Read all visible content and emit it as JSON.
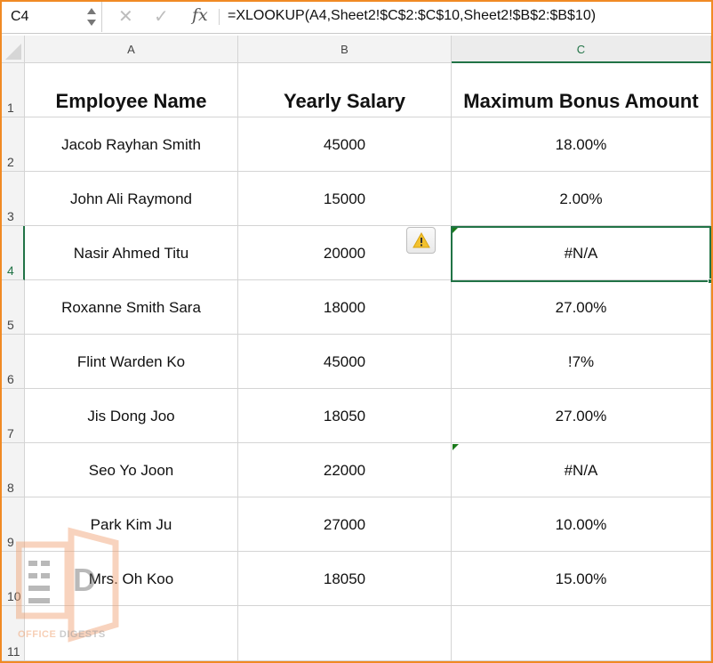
{
  "formula_bar": {
    "name_box": "C4",
    "cancel_icon": "x-icon",
    "enter_icon": "check-icon",
    "fx_label": "fx",
    "formula": "=XLOOKUP(A4,Sheet2!$C$2:$C$10,Sheet2!$B$2:$B$10)"
  },
  "columns": [
    "A",
    "B",
    "C"
  ],
  "selected_column": "C",
  "rows": [
    "1",
    "2",
    "3",
    "4",
    "5",
    "6",
    "7",
    "8",
    "9",
    "10",
    "11"
  ],
  "selected_row": "4",
  "selected_cell": "C4",
  "table": {
    "headers": [
      "Employee Name",
      "Yearly Salary",
      "Maximum Bonus Amount"
    ],
    "data": [
      [
        "Jacob Rayhan Smith",
        "45000",
        "18.00%"
      ],
      [
        "John Ali Raymond",
        "15000",
        "2.00%"
      ],
      [
        "Nasir Ahmed Titu",
        "20000",
        "#N/A"
      ],
      [
        "Roxanne Smith Sara",
        "18000",
        "27.00%"
      ],
      [
        "Flint Warden Ko",
        "45000",
        "!7%"
      ],
      [
        "Jis Dong Joo",
        "18050",
        "27.00%"
      ],
      [
        "Seo Yo Joon",
        "22000",
        "#N/A"
      ],
      [
        "Park Kim Ju",
        "27000",
        "10.00%"
      ],
      [
        "Mrs. Oh Koo",
        "18050",
        "15.00%"
      ],
      [
        "",
        "",
        ""
      ]
    ]
  },
  "error_indicator_cells": [
    "C4",
    "C8"
  ],
  "warning_button_icon": "warning-triangle-icon",
  "watermark": {
    "part1": "OFFICE",
    "part2": " DIGESTS",
    "letter": "D"
  },
  "colors": {
    "accent": "#217346",
    "frame": "#f08a24",
    "warning": "#f2c12e"
  }
}
